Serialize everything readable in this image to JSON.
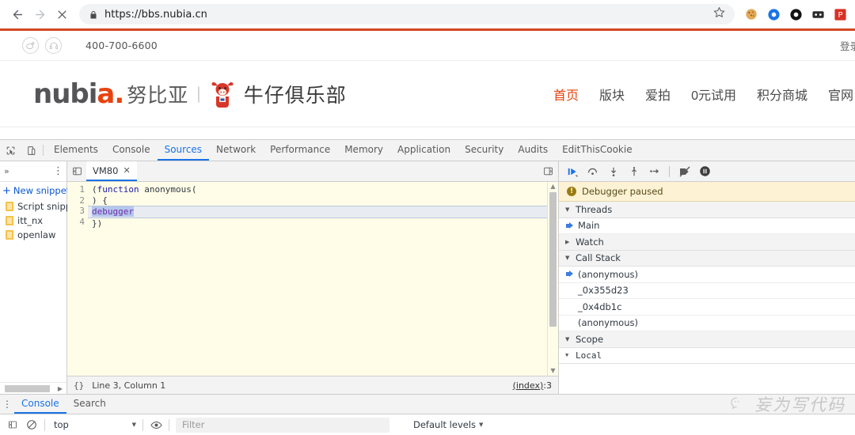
{
  "browser": {
    "back_title": "Back",
    "forward_title": "Forward",
    "stop_title": "Stop",
    "url": "https://bbs.nubia.cn",
    "lock_icon": "lock-icon",
    "star_icon": "bookmark-star-icon",
    "extensions": [
      {
        "name": "cookie-extension-icon",
        "color": "#e8b96a"
      },
      {
        "name": "blue-circle-extension-icon",
        "color": "#1a73e8"
      },
      {
        "name": "black-ring-extension-icon",
        "color": "#111111"
      },
      {
        "name": "dark-panel-extension-icon",
        "color": "#2b2b2b"
      },
      {
        "name": "red-extension-icon",
        "color": "#d93025"
      }
    ],
    "accent_color": "#d44722"
  },
  "site": {
    "topbar": {
      "weibo_icon": "weibo-icon",
      "support_icon": "headset-icon",
      "phone": "400-700-6600",
      "login": "登录"
    },
    "logo": {
      "brand": "nubia",
      "brand_cn": "努比亚",
      "separator": "|",
      "mascot_icon": "cow-mascot-icon",
      "club": "牛仔俱乐部",
      "accent_color": "#e8420f"
    },
    "nav": [
      {
        "label": "首页",
        "active": true
      },
      {
        "label": "版块",
        "active": false
      },
      {
        "label": "爱拍",
        "active": false
      },
      {
        "label": "0元试用",
        "active": false
      },
      {
        "label": "积分商城",
        "active": false
      },
      {
        "label": "官网",
        "active": false
      }
    ]
  },
  "devtools": {
    "inspect_icon": "inspect-element-icon",
    "device_icon": "device-toolbar-icon",
    "tabs": [
      {
        "label": "Elements",
        "active": false
      },
      {
        "label": "Console",
        "active": false
      },
      {
        "label": "Sources",
        "active": true
      },
      {
        "label": "Network",
        "active": false
      },
      {
        "label": "Performance",
        "active": false
      },
      {
        "label": "Memory",
        "active": false
      },
      {
        "label": "Application",
        "active": false
      },
      {
        "label": "Security",
        "active": false
      },
      {
        "label": "Audits",
        "active": false
      },
      {
        "label": "EditThisCookie",
        "active": false
      }
    ],
    "navigator": {
      "more_icon": "more-options-icon",
      "new_snippet": "New snippet",
      "plus_icon": "plus-icon",
      "items": [
        {
          "label": "Script snipp",
          "icon": "snippet-file-icon"
        },
        {
          "label": "itt_nx",
          "icon": "snippet-file-icon"
        },
        {
          "label": "openlaw",
          "icon": "snippet-file-icon"
        }
      ]
    },
    "editor": {
      "panel_toggle_icon": "show-navigator-icon",
      "right_toggle_icon": "show-debugger-icon",
      "tab_label": "VM80",
      "close_icon": "close-icon",
      "lines": [
        {
          "n": "1",
          "text": "(function anonymous(",
          "exec": false
        },
        {
          "n": "2",
          "text": ") {",
          "exec": false
        },
        {
          "n": "3",
          "text": "debugger",
          "exec": true
        },
        {
          "n": "4",
          "text": "})",
          "exec": false
        }
      ],
      "status": {
        "format_icon": "pretty-print-icon",
        "format_label": "{}",
        "position": "Line 3, Column 1",
        "source_link": "(index)",
        "source_line": ":3"
      }
    },
    "debugger": {
      "toolbar": [
        {
          "name": "resume-script-button",
          "icon": "resume-icon"
        },
        {
          "name": "step-over-button",
          "icon": "step-over-icon"
        },
        {
          "name": "step-into-button",
          "icon": "step-into-icon"
        },
        {
          "name": "step-out-button",
          "icon": "step-out-icon"
        },
        {
          "name": "step-button",
          "icon": "step-icon"
        },
        {
          "name": "deactivate-breakpoints-button",
          "icon": "deactivate-breakpoints-icon"
        },
        {
          "name": "pause-on-exceptions-button",
          "icon": "pause-on-exceptions-icon"
        }
      ],
      "paused_banner": "Debugger paused",
      "paused_icon": "info-icon",
      "threads_label": "Threads",
      "threads": [
        {
          "label": "Main",
          "current": true
        }
      ],
      "watch_label": "Watch",
      "call_stack_label": "Call Stack",
      "call_stack": [
        {
          "label": "(anonymous)",
          "current": true
        },
        {
          "label": "_0x355d23",
          "current": false
        },
        {
          "label": "_0x4db1c",
          "current": false
        },
        {
          "label": "(anonymous)",
          "current": false
        }
      ],
      "scope_label": "Scope",
      "scope_local_label": "Local"
    },
    "drawer": {
      "kebab_icon": "more-tools-icon",
      "tabs": [
        {
          "label": "Console",
          "active": true
        },
        {
          "label": "Search",
          "active": false
        }
      ],
      "sidebar_icon": "console-sidebar-icon",
      "clear_icon": "clear-console-icon",
      "context": "top",
      "eye_icon": "live-expression-icon",
      "filter_placeholder": "Filter",
      "levels": "Default levels"
    }
  },
  "watermark": {
    "icon": "wechat-icon",
    "text": "妄为写代码"
  }
}
